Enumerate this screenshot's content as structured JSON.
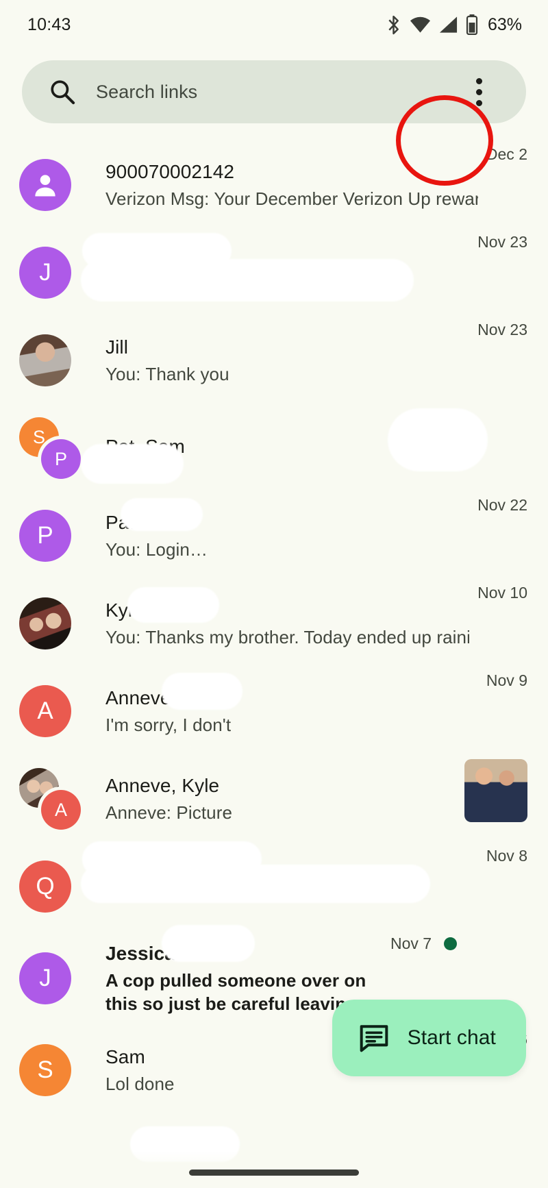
{
  "status_bar": {
    "time": "10:43",
    "battery_percent": "63%",
    "icons": [
      "bluetooth-icon",
      "wifi-icon",
      "cellular-signal-icon",
      "battery-icon"
    ]
  },
  "search": {
    "placeholder": "Search links",
    "icon": "search-icon",
    "overflow_icon": "overflow-menu-icon"
  },
  "annotation": {
    "shape": "ellipse",
    "color": "#e8150f",
    "target": "overflow-menu-icon"
  },
  "fab": {
    "label": "Start chat",
    "icon": "chat-bubble-icon",
    "bg": "#9befbd",
    "fg": "#0b2216"
  },
  "colors": {
    "background": "#f9faf2",
    "search_bg": "#dee5d9",
    "avatar_purple": "#ae5ae8",
    "avatar_orange": "#f58634",
    "avatar_red": "#ea5a4f",
    "unread_dot": "#0e6b40",
    "text_primary": "#1b1c18",
    "text_secondary": "#43483f"
  },
  "conversations": [
    {
      "name": "900070002142",
      "snippet": "Verizon Msg: Your December Verizon Up rewar…",
      "date": "Dec 2",
      "avatar": {
        "type": "person-icon",
        "color": "#ae5ae8"
      },
      "unread": false,
      "name_redacted": false,
      "snippet_redacted": false
    },
    {
      "name": "",
      "snippet": "",
      "date": "Nov 23",
      "avatar": {
        "type": "initial",
        "initial": "J",
        "color": "#ae5ae8"
      },
      "unread": false,
      "name_redacted": true,
      "snippet_redacted": true
    },
    {
      "name": "Jill",
      "snippet": "You: Thank you",
      "date": "Nov 23",
      "avatar": {
        "type": "photo",
        "photo": "jill-photo"
      },
      "unread": false,
      "name_redacted": false,
      "snippet_redacted": false
    },
    {
      "name": "Pat, Sam",
      "snippet": "",
      "date": "",
      "avatar": {
        "type": "group-initials",
        "initial1": "S",
        "color1": "#f58634",
        "initial2": "P",
        "color2": "#ae5ae8"
      },
      "unread": false,
      "name_redacted": false,
      "snippet_redacted": true,
      "date_redacted": true
    },
    {
      "name": "Pat",
      "snippet": "You: Login…",
      "date": "Nov 22",
      "avatar": {
        "type": "initial",
        "initial": "P",
        "color": "#ae5ae8"
      },
      "unread": false,
      "name_redacted": false,
      "snippet_redacted": false
    },
    {
      "name": "Kyle",
      "snippet": "You: Thanks my brother. Today ended up raini…",
      "date": "Nov 10",
      "avatar": {
        "type": "photo",
        "photo": "kyle-photo"
      },
      "unread": false,
      "name_redacted": false,
      "snippet_redacted": false
    },
    {
      "name": "Anneve",
      "snippet": "I'm sorry, I don't",
      "date": "Nov 9",
      "avatar": {
        "type": "initial",
        "initial": "A",
        "color": "#ea5a4f"
      },
      "unread": false,
      "name_redacted": false,
      "snippet_redacted": false
    },
    {
      "name": "Anneve, Kyle",
      "snippet": "Anneve: Picture",
      "date": "",
      "avatar": {
        "type": "group-photo-initial",
        "photo": "anneve-kyle-photo",
        "initial2": "A",
        "color2": "#ea5a4f"
      },
      "thumbnail": "two-men-in-suits-photo",
      "unread": false,
      "name_redacted": false,
      "snippet_redacted": false
    },
    {
      "name": "",
      "snippet": "",
      "date": "Nov 8",
      "avatar": {
        "type": "initial",
        "initial": "Q",
        "color": "#ea5a4f"
      },
      "unread": false,
      "name_redacted": true,
      "snippet_redacted": true
    },
    {
      "name": "Jessica",
      "snippet": "A cop pulled someone over on this so just be careful leaving.",
      "date": "Nov 7",
      "avatar": {
        "type": "initial",
        "initial": "J",
        "color": "#ae5ae8"
      },
      "unread": true,
      "name_redacted": false,
      "snippet_redacted": false
    },
    {
      "name": "Sam",
      "snippet": "Lol done",
      "date": "Nov 6",
      "avatar": {
        "type": "initial",
        "initial": "S",
        "color": "#f58634"
      },
      "unread": false,
      "name_redacted": false,
      "snippet_redacted": false
    }
  ]
}
